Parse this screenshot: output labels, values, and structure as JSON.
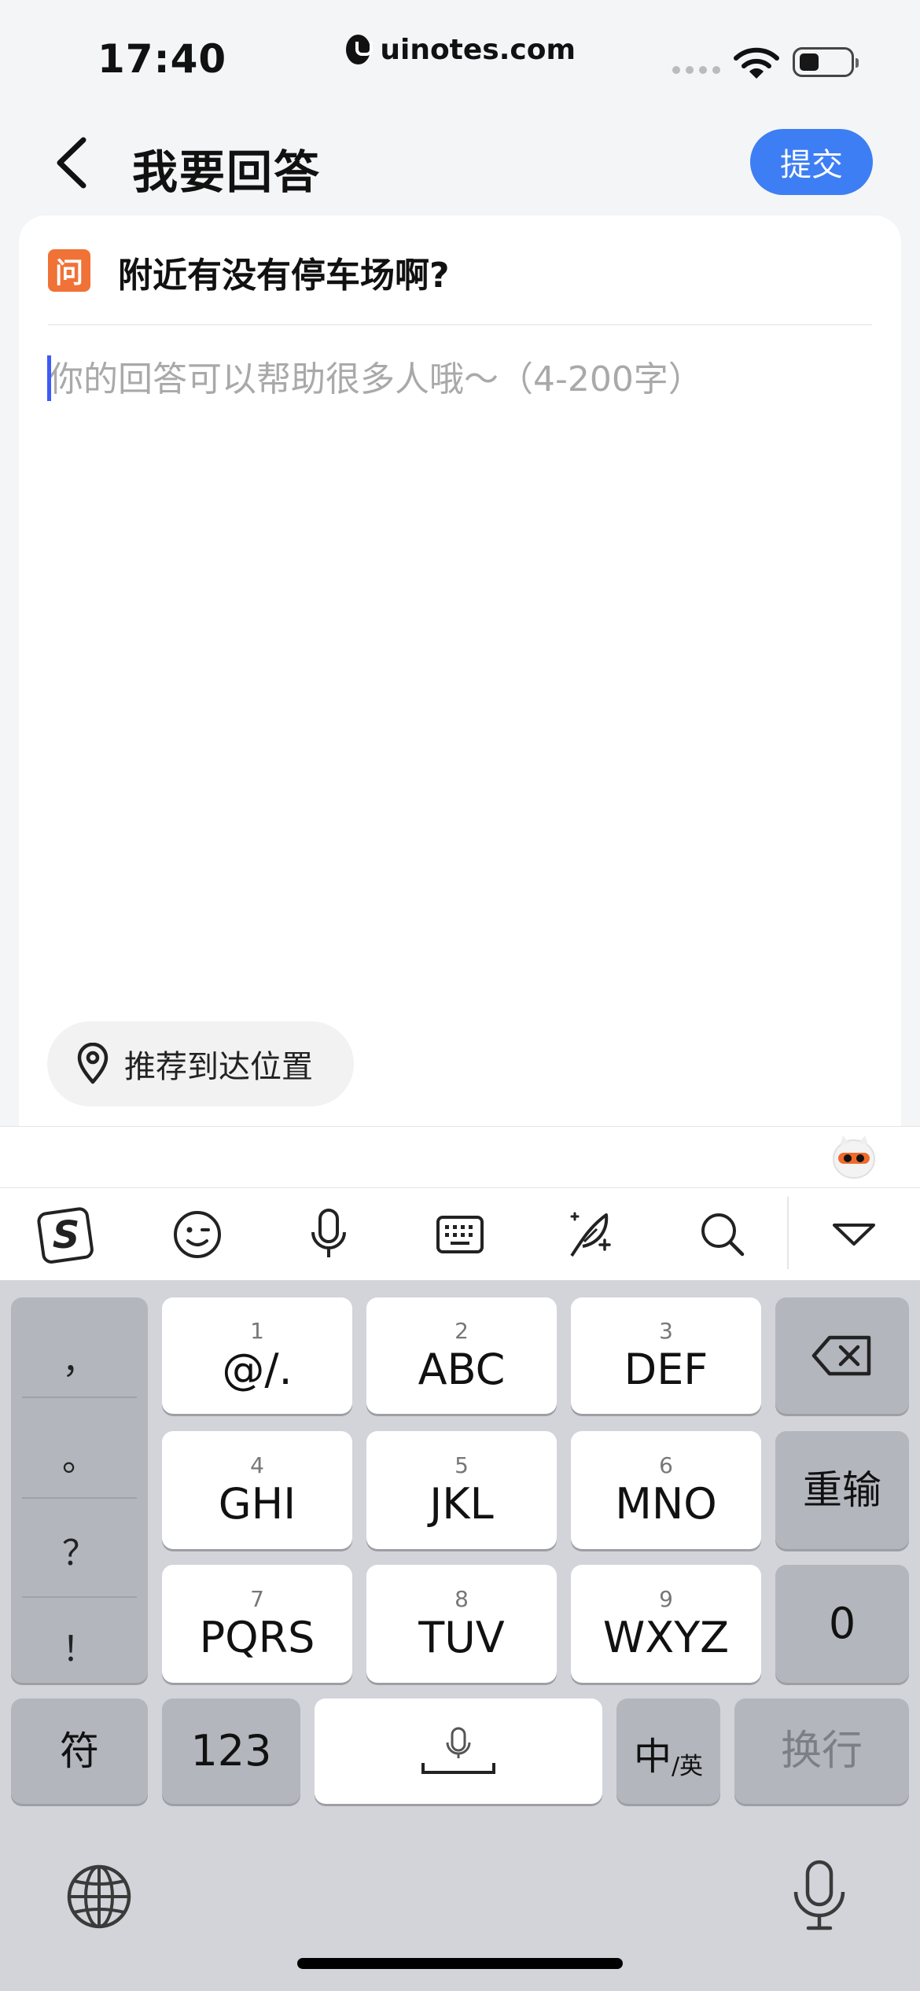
{
  "status_bar": {
    "time": "17:40",
    "url": "uinotes.com"
  },
  "nav": {
    "title": "我要回答",
    "submit_label": "提交"
  },
  "question": {
    "badge": "问",
    "text": "附近有没有停车场啊?"
  },
  "answer": {
    "value": "",
    "placeholder": "你的回答可以帮助很多人哦～（4-200字）"
  },
  "location": {
    "label": "推荐到达位置"
  },
  "toolbar": {
    "icons": [
      "sogou-logo-icon",
      "emoji-icon",
      "microphone-icon",
      "keyboard-icon",
      "handwriting-icon",
      "search-icon",
      "collapse-keyboard-icon"
    ]
  },
  "keyboard": {
    "punctuation": [
      "，",
      "。",
      "？",
      "！"
    ],
    "keys": [
      {
        "num": "1",
        "label": "@/."
      },
      {
        "num": "2",
        "label": "ABC"
      },
      {
        "num": "3",
        "label": "DEF"
      },
      {
        "num": "4",
        "label": "GHI"
      },
      {
        "num": "5",
        "label": "JKL"
      },
      {
        "num": "6",
        "label": "MNO"
      },
      {
        "num": "7",
        "label": "PQRS"
      },
      {
        "num": "8",
        "label": "TUV"
      },
      {
        "num": "9",
        "label": "WXYZ"
      }
    ],
    "reset_label": "重输",
    "zero_label": "0",
    "symbols_label": "符",
    "numbers_label": "123",
    "lang_main": "中",
    "lang_sub": "/英",
    "return_label": "换行"
  },
  "colors": {
    "accent": "#3d7ef4",
    "question_badge": "#f07236",
    "caret": "#3d5bf5"
  }
}
